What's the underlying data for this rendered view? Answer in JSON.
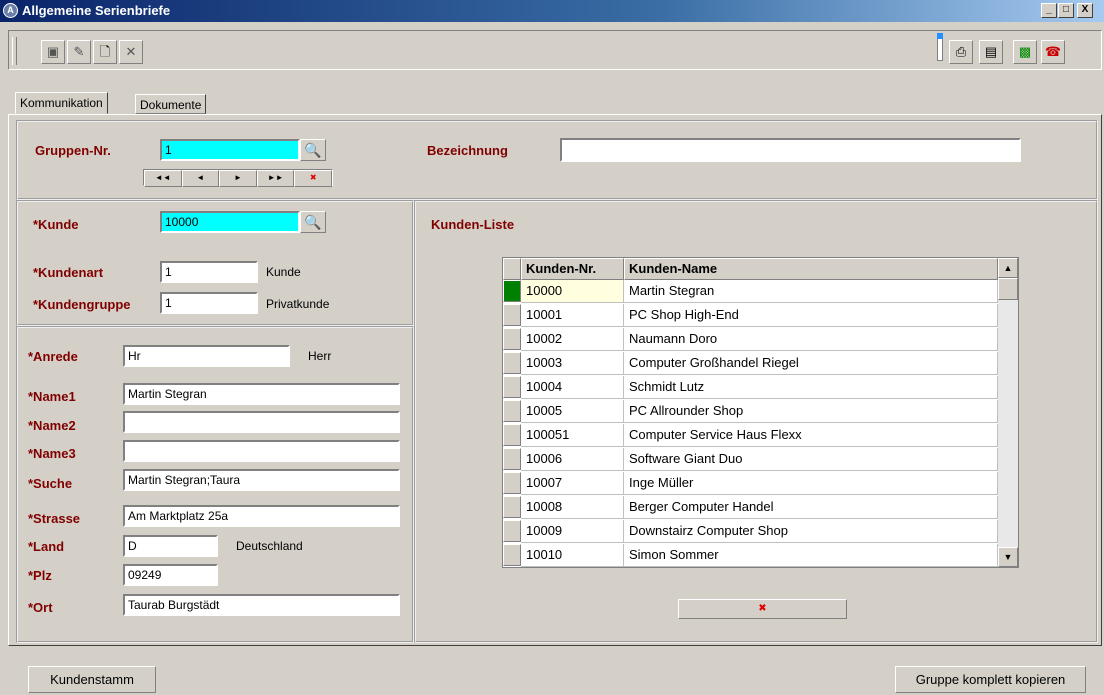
{
  "window": {
    "title": "Allgemeine Serienbriefe",
    "app_icon": "A",
    "min": "_",
    "max": "□",
    "close": "X"
  },
  "tabs": [
    {
      "label": "Kommunikation"
    },
    {
      "label": "Dokumente"
    }
  ],
  "group": {
    "nr_label": "Gruppen-Nr.",
    "nr_value": "1",
    "bez_label": "Bezeichnung",
    "bez_value": "",
    "nav": [
      "◄◄",
      "◄",
      "►",
      "►►",
      "✖"
    ]
  },
  "customer": {
    "kunde_label": "*Kunde",
    "kunde_value": "10000",
    "kundenart_label": "*Kundenart",
    "kundenart_value": "1",
    "kundenart_text": "Kunde",
    "kundengruppe_label": "*Kundengruppe",
    "kundengruppe_value": "1",
    "kundengruppe_text": "Privatkunde"
  },
  "address": {
    "anrede_label": "*Anrede",
    "anrede_value": "Hr",
    "anrede_text": "Herr",
    "name1_label": "*Name1",
    "name1_value": "Martin Stegran",
    "name2_label": "*Name2",
    "name2_value": "",
    "name3_label": "*Name3",
    "name3_value": "",
    "suche_label": "*Suche",
    "suche_value": "Martin Stegran;Taura",
    "strasse_label": "*Strasse",
    "strasse_value": "Am Marktplatz 25a",
    "land_label": "*Land",
    "land_value": "D",
    "land_text": "Deutschland",
    "plz_label": "*Plz",
    "plz_value": "09249",
    "ort_label": "*Ort",
    "ort_value": "Taurab Burgstädt"
  },
  "list": {
    "title": "Kunden-Liste",
    "col_nr": "Kunden-Nr.",
    "col_name": "Kunden-Name",
    "rows": [
      {
        "nr": "10000",
        "name": "Martin Stegran"
      },
      {
        "nr": "10001",
        "name": "PC Shop High-End"
      },
      {
        "nr": "10002",
        "name": "Naumann Doro"
      },
      {
        "nr": "10003",
        "name": "Computer Großhandel Riegel"
      },
      {
        "nr": "10004",
        "name": "Schmidt Lutz"
      },
      {
        "nr": "10005",
        "name": "PC Allrounder Shop"
      },
      {
        "nr": "100051",
        "name": "Computer Service Haus Flexx"
      },
      {
        "nr": "10006",
        "name": "Software Giant Duo"
      },
      {
        "nr": "10007",
        "name": "Inge Müller"
      },
      {
        "nr": "10008",
        "name": "Berger Computer Handel"
      },
      {
        "nr": "10009",
        "name": "Downstairz Computer Shop"
      },
      {
        "nr": "10010",
        "name": "Simon Sommer"
      }
    ],
    "delete_glyph": "✖"
  },
  "footer": {
    "left_button": "Kundenstamm",
    "right_button": "Gruppe komplett kopieren"
  },
  "icons": {
    "lookup": "🔍"
  }
}
